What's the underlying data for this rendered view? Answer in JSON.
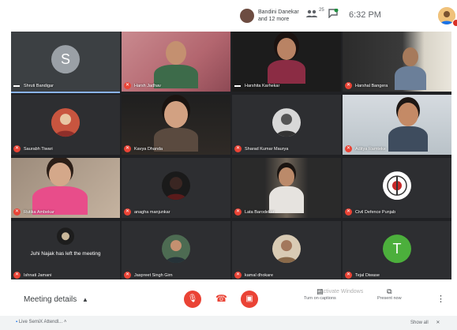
{
  "topbar": {
    "presenter_line1": "Bandini Danekar",
    "presenter_line2": "and 12 more",
    "people_icon": "people-icon",
    "people_count": "25",
    "chat_icon": "chat-icon",
    "time": "6:32 PM"
  },
  "tiles": [
    {
      "name": "Shruti Bandigar",
      "type": "letter",
      "letter": "S",
      "color": "#9aa0a6",
      "muted": false
    },
    {
      "name": "Harsh Jadhav",
      "type": "camera",
      "muted": true
    },
    {
      "name": "Harshita Karhekar",
      "type": "camera",
      "muted": false
    },
    {
      "name": "Harshal Bangera",
      "type": "camera",
      "muted": true
    },
    {
      "name": "Saurabh Tiwari",
      "type": "avatar",
      "muted": true
    },
    {
      "name": "Kavya Dhanda",
      "type": "camera",
      "muted": true
    },
    {
      "name": "Sharad Kumar Maurya",
      "type": "avatar",
      "muted": true
    },
    {
      "name": "Aditya Ramteke",
      "type": "camera",
      "muted": true
    },
    {
      "name": "Rutika Ambekar",
      "type": "camera",
      "muted": true
    },
    {
      "name": "anagha manjunkar",
      "type": "avatar",
      "muted": true
    },
    {
      "name": "Lata Barodekar",
      "type": "camera",
      "muted": true
    },
    {
      "name": "Civil Defence Punjab",
      "type": "avatar",
      "muted": true
    },
    {
      "name": "Ishnati Jamani",
      "type": "msg",
      "message": "Juhi Najak has left the meeting",
      "muted": true
    },
    {
      "name": "Jaspreet Singh Girn",
      "type": "camera",
      "muted": true
    },
    {
      "name": "kamal dhokare",
      "type": "avatar",
      "muted": true
    },
    {
      "name": "Tejal Diwase",
      "type": "letter",
      "letter": "T",
      "color": "#4caf3c",
      "muted": true
    }
  ],
  "bottombar": {
    "meeting_details": "Meeting details",
    "captions_label": "Turn on captions",
    "present_label": "Present now",
    "watermark": "Activate Windows"
  },
  "download": {
    "file": "Live SemiX Attendl...",
    "show_all": "Show all"
  }
}
